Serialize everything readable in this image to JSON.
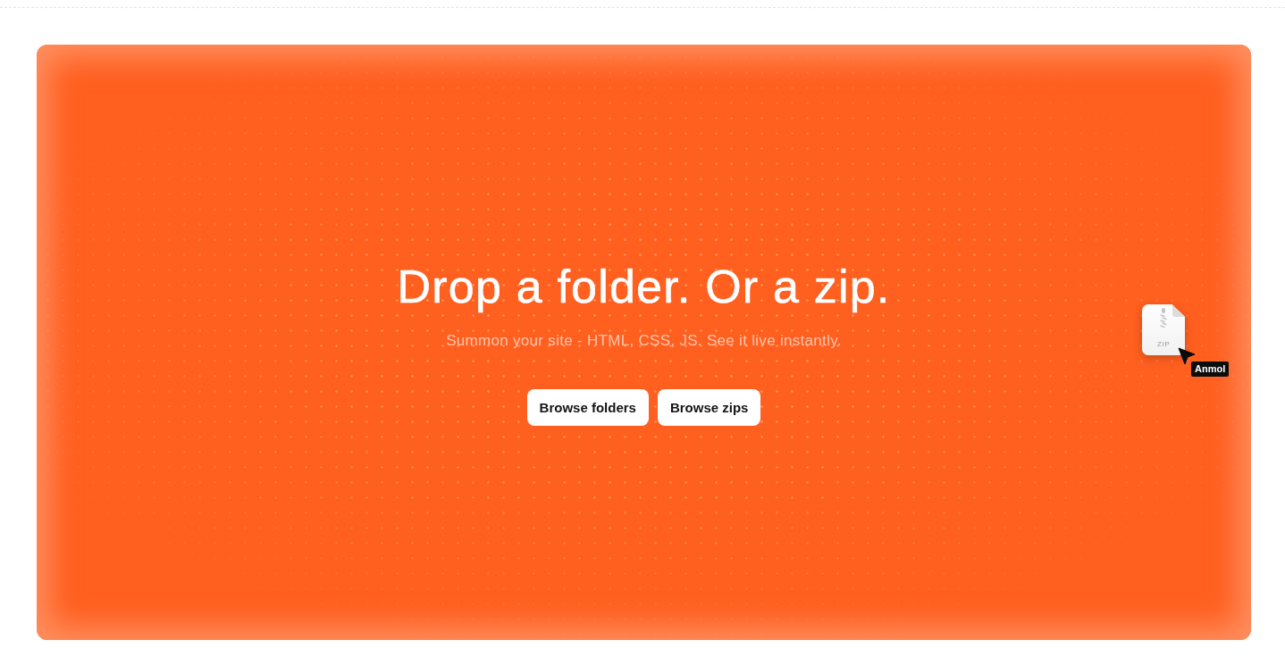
{
  "hero": {
    "title": "Drop a folder. Or a zip.",
    "subtitle": "Summon your site - HTML, CSS, JS. See it live instantly.",
    "buttons": [
      "Browse folders",
      "Browse zips"
    ]
  },
  "dragged_file": {
    "type_label": "ZIP",
    "user_tag": "Anmol"
  }
}
